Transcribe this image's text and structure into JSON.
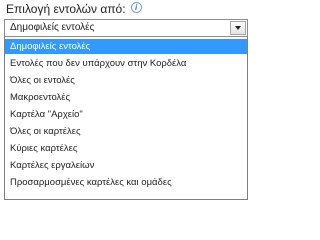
{
  "label": {
    "text": "Επιλογή εντολών από:",
    "info_icon": "info-icon"
  },
  "select": {
    "value": "Δημοφιλείς εντολές",
    "arrow_icon": "chevron-down-icon"
  },
  "dropdown": {
    "items": [
      {
        "label": "Δημοφιλείς εντολές",
        "selected": true
      },
      {
        "label": "Εντολές που δεν υπάρχουν στην Κορδέλα",
        "selected": false
      },
      {
        "label": "Όλες οι εντολές",
        "selected": false
      },
      {
        "label": "Μακροεντολές",
        "selected": false
      },
      {
        "label": "Καρτέλα \"Αρχείο\"",
        "selected": false
      },
      {
        "label": "Όλες οι καρτέλες",
        "selected": false
      },
      {
        "label": "Κύριες καρτέλες",
        "selected": false
      },
      {
        "label": "Καρτέλες εργαλείων",
        "selected": false
      },
      {
        "label": "Προσαρμοσμένες καρτέλες και ομάδες",
        "selected": false
      }
    ]
  },
  "colors": {
    "selection": "#3399ff",
    "border": "#8c8c8c"
  }
}
